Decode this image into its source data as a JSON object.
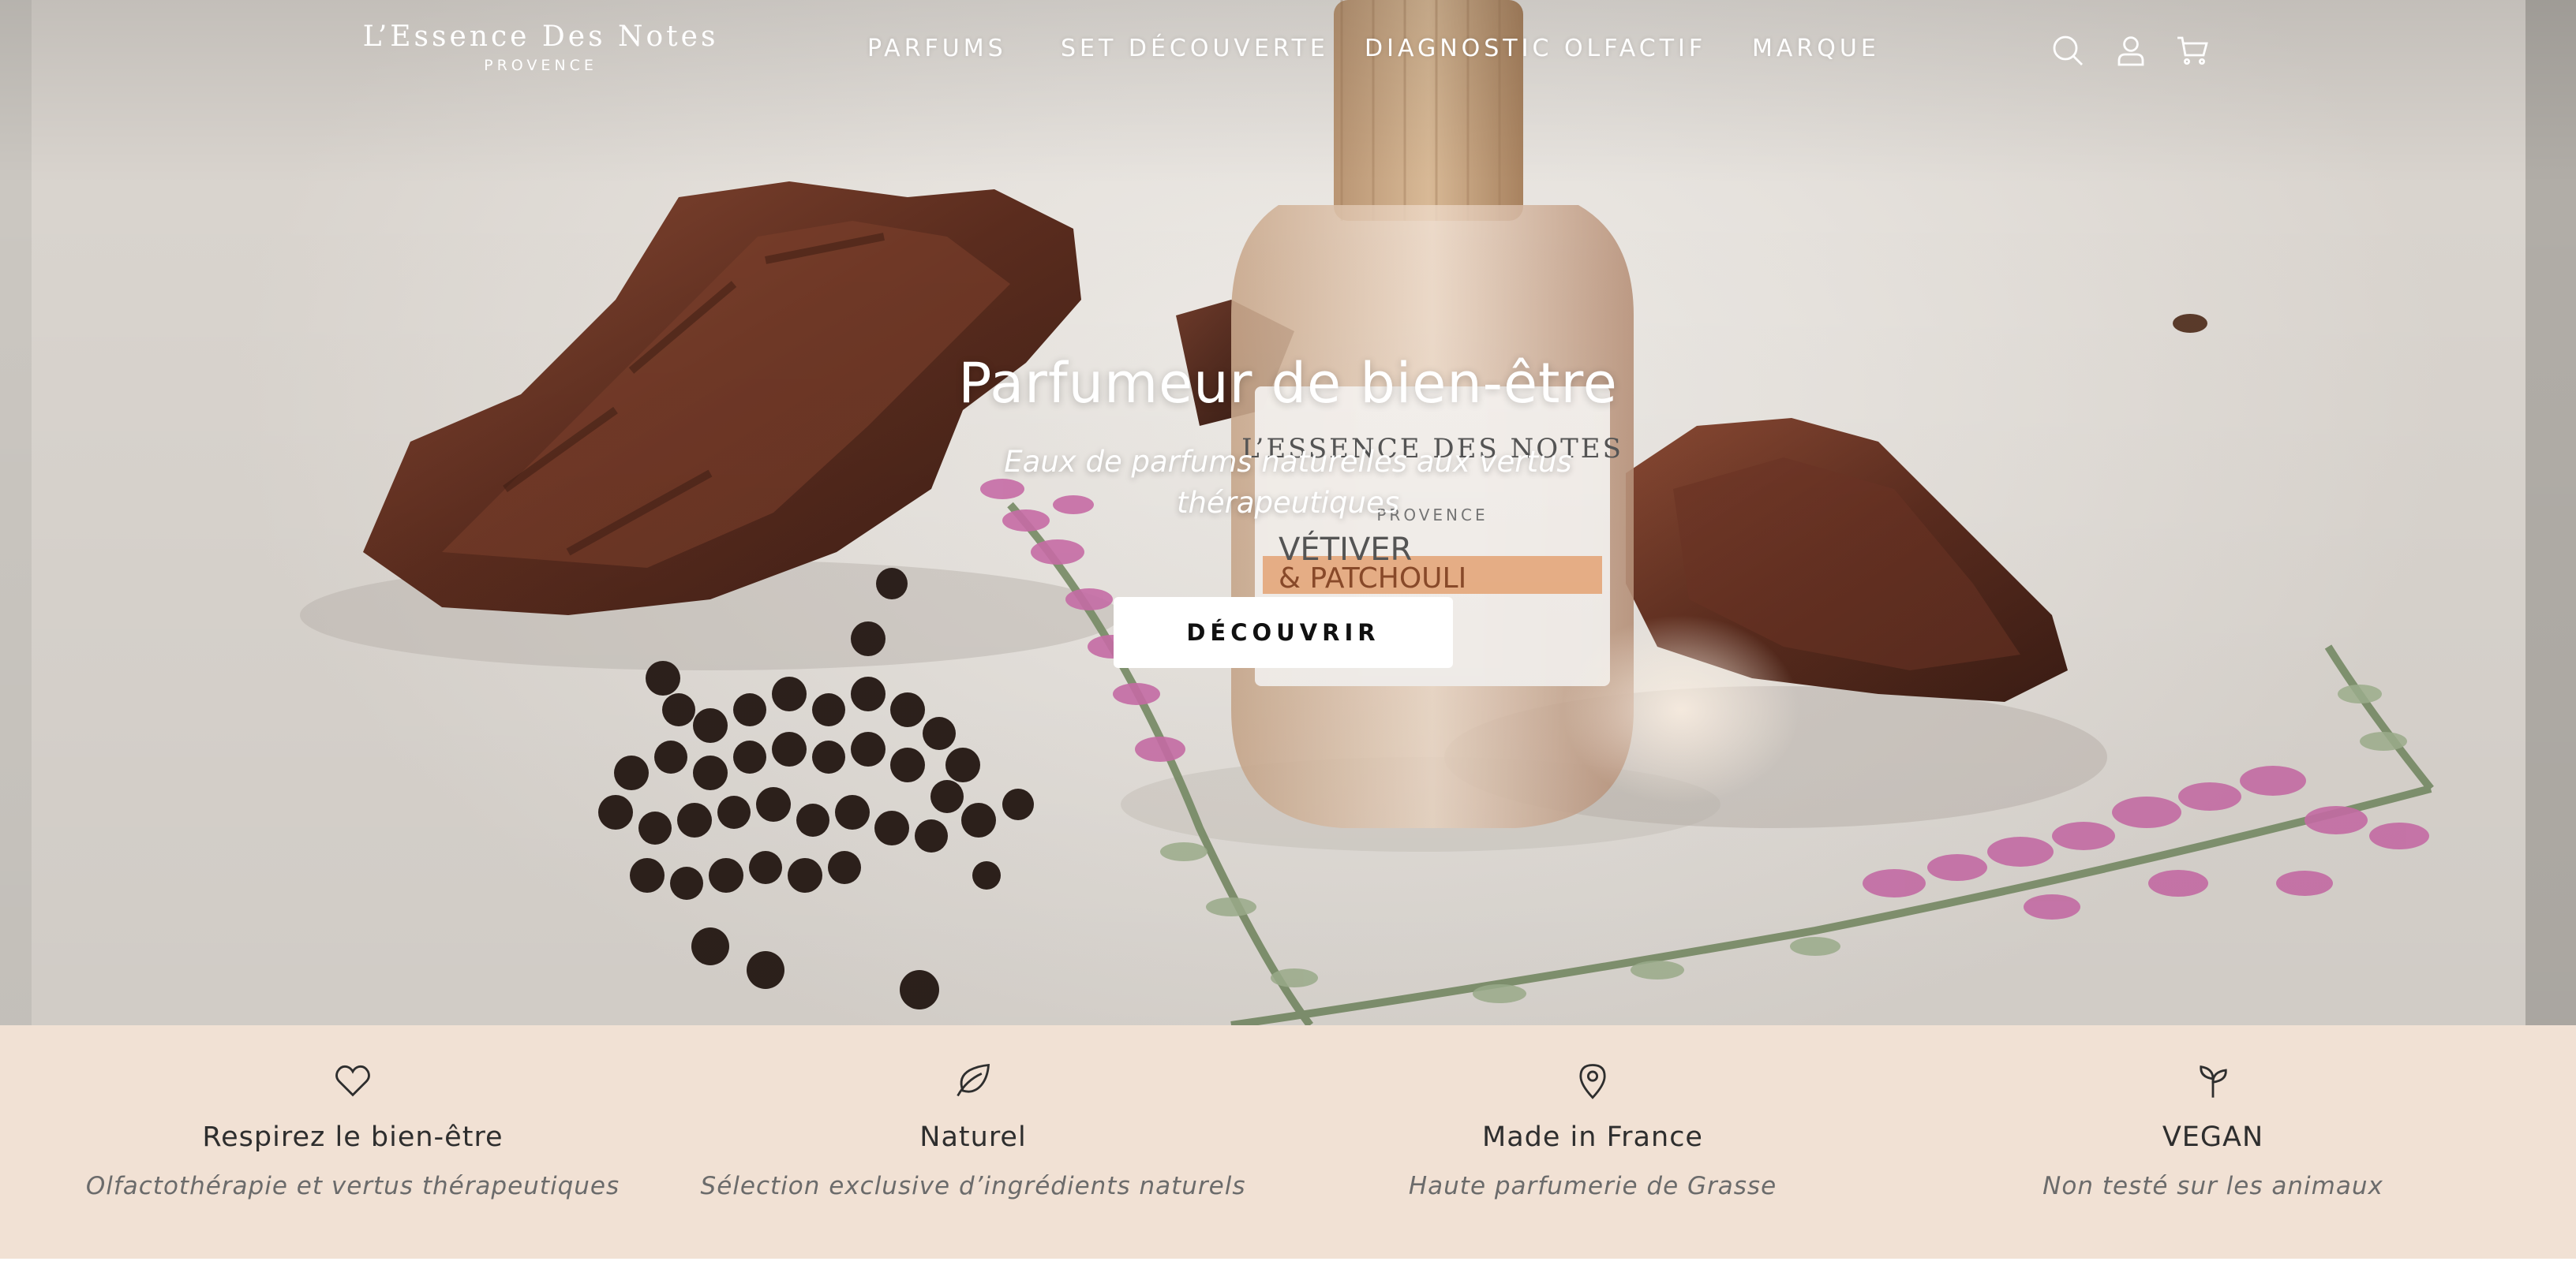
{
  "brand": {
    "name": "L’Essence Des Notes",
    "subtitle": "PROVENCE"
  },
  "nav": {
    "items": [
      {
        "label": "PARFUMS"
      },
      {
        "label": "SET DÉCOUVERTE"
      },
      {
        "label": "DIAGNOSTIC OLFACTIF"
      },
      {
        "label": "MARQUE"
      }
    ],
    "icons": [
      "search-icon",
      "account-icon",
      "cart-icon"
    ]
  },
  "hero": {
    "title": "Parfumeur de bien-être",
    "subtitle": "Eaux de parfums naturelles aux vertus thérapeutiques",
    "cta_label": "DÉCOUVRIR",
    "bottle_label": {
      "brand": "L’ESSENCE DES NOTES",
      "region": "PROVENCE",
      "line1": "VÉTIVER",
      "line2": "& PATCHOULI"
    }
  },
  "features": [
    {
      "icon": "heart-icon",
      "title": "Respirez le bien-être",
      "description": "Olfactothérapie et vertus thérapeutiques"
    },
    {
      "icon": "leaf-icon",
      "title": "Naturel",
      "description": "Sélection exclusive d’ingrédients naturels"
    },
    {
      "icon": "map-pin-icon",
      "title": "Made in France",
      "description": "Haute parfumerie de Grasse"
    },
    {
      "icon": "sprout-icon",
      "title": "VEGAN",
      "description": "Non testé sur les animaux"
    }
  ],
  "colors": {
    "features_background": "#f1e1d4",
    "hero_text": "#ffffff",
    "cta_background": "#ffffff",
    "cta_text": "#111111"
  }
}
